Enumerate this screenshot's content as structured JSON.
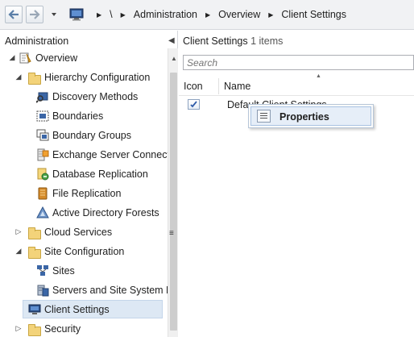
{
  "toolbar": {
    "back_icon": "back-arrow-icon",
    "forward_icon": "forward-arrow-icon",
    "dropdown_icon": "chevron-down-icon"
  },
  "breadcrumb": {
    "root_icon": "console-computer-icon",
    "items": [
      "\\",
      "Administration",
      "Overview",
      "Client Settings"
    ]
  },
  "navigation": {
    "title": "Administration",
    "tree": [
      {
        "label": "Overview",
        "icon": "overview-icon",
        "expander": "expanded"
      },
      {
        "label": "Hierarchy Configuration",
        "icon": "folder-icon",
        "expander": "expanded"
      },
      {
        "label": "Discovery Methods",
        "icon": "discovery-methods-icon"
      },
      {
        "label": "Boundaries",
        "icon": "boundaries-icon"
      },
      {
        "label": "Boundary Groups",
        "icon": "boundary-groups-icon"
      },
      {
        "label": "Exchange Server Connecto",
        "icon": "exchange-connector-icon"
      },
      {
        "label": "Database Replication",
        "icon": "database-replication-icon"
      },
      {
        "label": "File Replication",
        "icon": "file-replication-icon"
      },
      {
        "label": "Active Directory Forests",
        "icon": "active-directory-forests-icon"
      },
      {
        "label": "Cloud Services",
        "icon": "folder-icon",
        "expander": "collapsed"
      },
      {
        "label": "Site Configuration",
        "icon": "folder-icon",
        "expander": "expanded"
      },
      {
        "label": "Sites",
        "icon": "sites-icon"
      },
      {
        "label": "Servers and Site System Ro",
        "icon": "servers-icon"
      },
      {
        "label": "Client Settings",
        "icon": "client-settings-icon",
        "selected": true
      },
      {
        "label": "Security",
        "icon": "folder-icon",
        "expander": "collapsed"
      }
    ]
  },
  "content": {
    "title": "Client Settings",
    "count": "1 items",
    "search_placeholder": "Search",
    "columns": [
      "Icon",
      "Name"
    ],
    "rows": [
      {
        "icon": "client-settings-item-icon",
        "name": "Default Client Settings"
      }
    ]
  },
  "context_menu": {
    "items": [
      {
        "label": "Properties",
        "icon": "properties-icon"
      }
    ]
  },
  "colors": {
    "accent_selection": "#dde8f4",
    "folder": "#f3d37a",
    "menu_highlight": "#e6eef8"
  }
}
